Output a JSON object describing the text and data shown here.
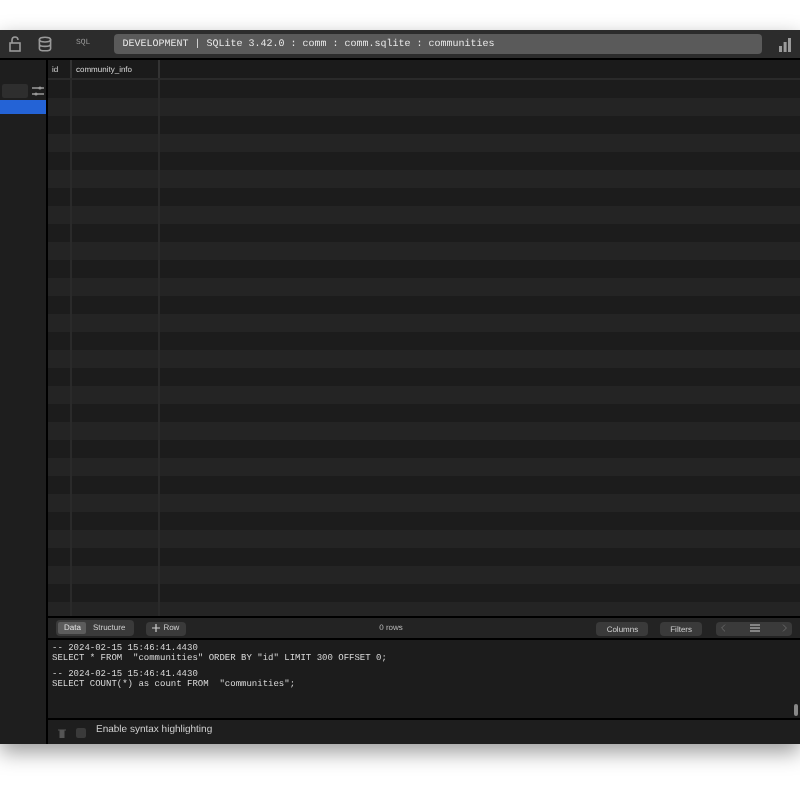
{
  "toolbar": {
    "label": "SQL",
    "breadcrumb": "DEVELOPMENT | SQLite 3.42.0 : comm : comm.sqlite : communities"
  },
  "sidebar": {
    "items": [
      {
        "selected": true
      }
    ]
  },
  "table": {
    "columns": [
      "id",
      "community_info"
    ]
  },
  "bottom_bar": {
    "tabs": [
      {
        "label": "Data",
        "selected": true
      },
      {
        "label": "Structure",
        "selected": false
      }
    ],
    "add_row": "Row",
    "row_count": "0 rows",
    "buttons": [
      "Columns",
      "Filters"
    ]
  },
  "console": {
    "entries": [
      {
        "timestamp": "-- 2024-02-15 15:46:41.4430",
        "query": "SELECT * FROM  \"communities\" ORDER BY \"id\" LIMIT 300 OFFSET 0;"
      },
      {
        "timestamp": "-- 2024-02-15 15:46:41.4430",
        "query": "SELECT COUNT(*) as count FROM  \"communities\";"
      }
    ]
  },
  "footer": {
    "syntax_highlighting": {
      "label": "Enable syntax highlighting",
      "checked": false
    }
  }
}
